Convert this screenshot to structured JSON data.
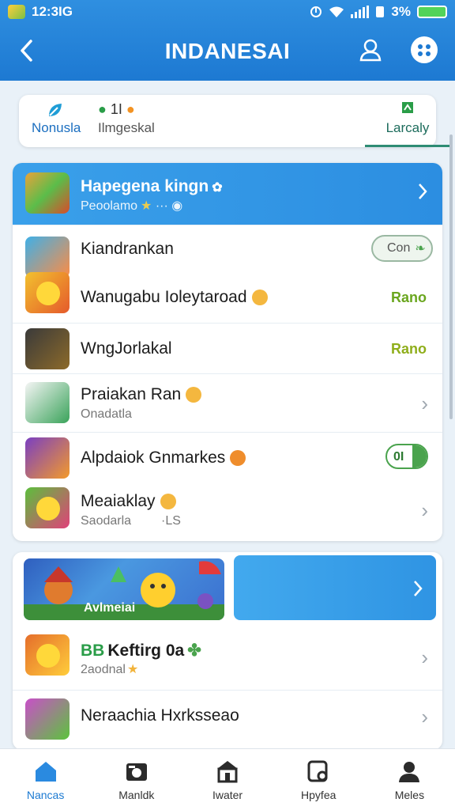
{
  "status_bar": {
    "time": "12:3IG",
    "battery": "3%"
  },
  "header": {
    "title": "INDANESAI",
    "back_icon": "chevron-left-icon",
    "user_icon": "user-icon",
    "more_icon": "dots-icon"
  },
  "tabs": [
    {
      "label": "Nonusla",
      "icon": "leaf-icon"
    },
    {
      "label": "Ilmgeskal",
      "icon_text": "1I"
    },
    {
      "label": "Larcaly",
      "icon": "flag-icon"
    }
  ],
  "list_header": {
    "title": "Hapegena kingn",
    "subtitle": "Peoolamo"
  },
  "rows": [
    {
      "title": "Kiandrankan",
      "action": "Con"
    },
    {
      "title": "Wanugabu Ioleytaroad",
      "status": "Rano"
    },
    {
      "title": "WngJorlakal",
      "status": "Rano"
    },
    {
      "title": "Praiakan Ran",
      "subtitle": "Onadatla"
    },
    {
      "title": "Alpdaiok Gnmarkes",
      "toggle": "0I"
    },
    {
      "title": "Meaiaklay",
      "subtitle": "Saodarla",
      "extra": "·LS"
    }
  ],
  "section2": {
    "banner_caption": "Avlmeiai",
    "row1_badge": "BB",
    "row1_title": "Keftirg 0a",
    "row1_subtitle": "2aodnal",
    "row2_title": "Neraachia Hxrksseao"
  },
  "nav": [
    {
      "label": "Nancas",
      "icon": "home-icon",
      "active": true
    },
    {
      "label": "Manldk",
      "icon": "camera-icon",
      "active": false
    },
    {
      "label": "Iwater",
      "icon": "store-icon",
      "active": false
    },
    {
      "label": "Hpyfea",
      "icon": "search-doc-icon",
      "active": false
    },
    {
      "label": "Meles",
      "icon": "profile-icon",
      "active": false
    }
  ],
  "colors": {
    "brand_blue": "#1d79d2",
    "status_green": "#6aa61e",
    "banner_blue": "#3aa0ea"
  }
}
